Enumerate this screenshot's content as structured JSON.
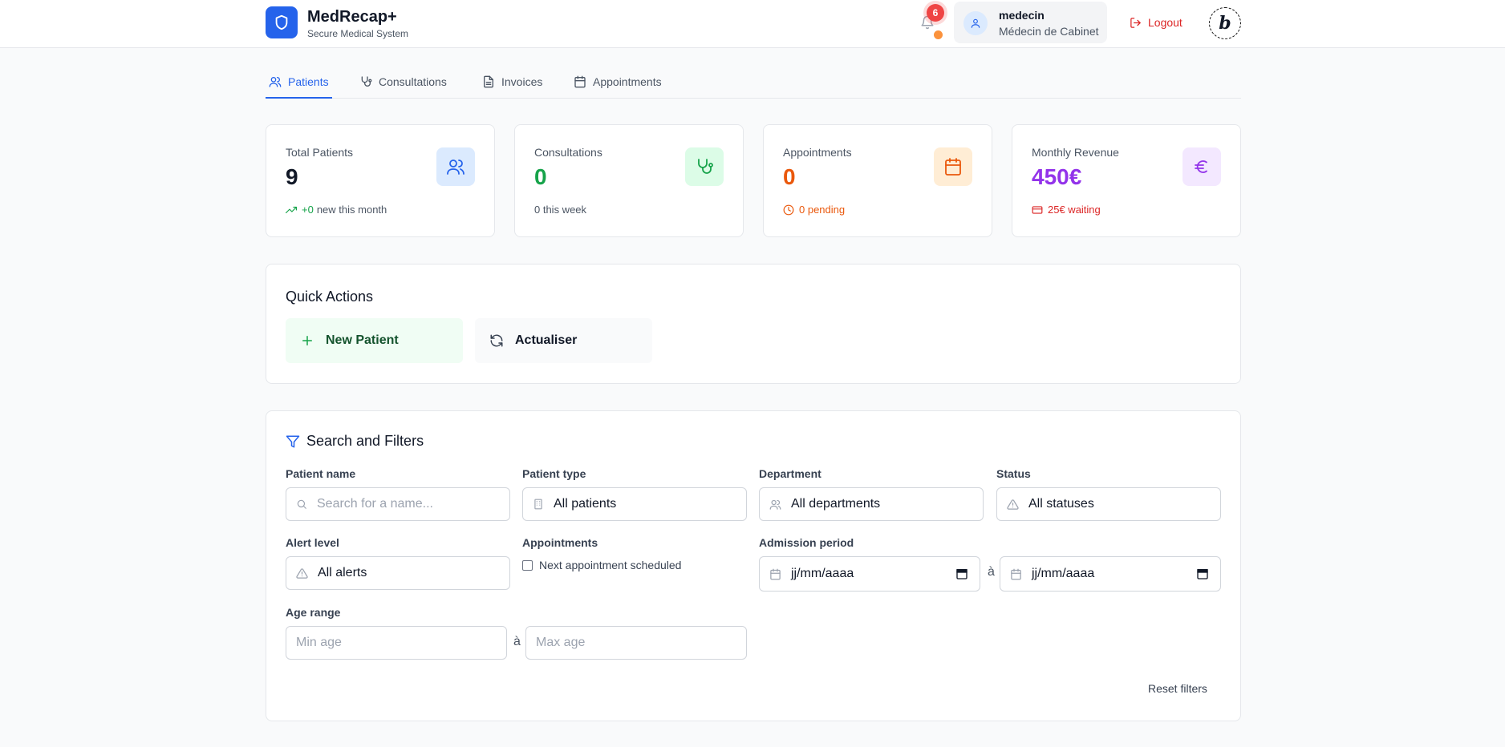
{
  "header": {
    "app_title": "MedRecap+",
    "app_subtitle": "Secure Medical System",
    "notifications_count": "6",
    "user_name": "medecin",
    "user_role": "Médecin de Cabinet",
    "logout_label": "Logout",
    "brand_letter": "b"
  },
  "tabs": [
    {
      "label": "Patients",
      "icon": "users-icon",
      "active": true
    },
    {
      "label": "Consultations",
      "icon": "stethoscope-icon",
      "active": false
    },
    {
      "label": "Invoices",
      "icon": "file-icon",
      "active": false
    },
    {
      "label": "Appointments",
      "icon": "calendar-icon",
      "active": false
    }
  ],
  "stats": [
    {
      "label": "Total Patients",
      "value": "9",
      "foot": "+0",
      "foot_suffix": " new this month",
      "value_color": "#111827",
      "foot_color": "#16a34a",
      "icon": "users-icon",
      "icon_bg": "#dbeafe",
      "icon_color": "#2563eb"
    },
    {
      "label": "Consultations",
      "value": "0",
      "foot": "0 this week",
      "value_color": "#16a34a",
      "foot_color": "#4b5563",
      "icon": "stethoscope-icon",
      "icon_bg": "#dcfce7",
      "icon_color": "#16a34a"
    },
    {
      "label": "Appointments",
      "value": "0",
      "foot": "0 pending",
      "value_color": "#ea580c",
      "foot_color": "#ea580c",
      "icon": "calendar-icon",
      "icon_bg": "#ffedd5",
      "icon_color": "#ea580c"
    },
    {
      "label": "Monthly Revenue",
      "value": "450€",
      "foot": "25€ waiting",
      "value_color": "#9333ea",
      "foot_color": "#dc2626",
      "icon": "euro-icon",
      "icon_bg": "#f3e8ff",
      "icon_color": "#9333ea"
    }
  ],
  "quick_actions": {
    "title": "Quick Actions",
    "new_patient": "New Patient",
    "refresh": "Actualiser"
  },
  "filters": {
    "title": "Search and Filters",
    "patient_name_label": "Patient name",
    "patient_name_placeholder": "Search for a name...",
    "patient_type_label": "Patient type",
    "patient_type_value": "All patients",
    "department_label": "Department",
    "department_value": "All departments",
    "status_label": "Status",
    "status_value": "All statuses",
    "alert_label": "Alert level",
    "alert_value": "All alerts",
    "appointments_label": "Appointments",
    "appointments_checkbox": "Next appointment scheduled",
    "admission_label": "Admission period",
    "date_placeholder": "jj/mm/aaaa",
    "range_sep": "à",
    "age_label": "Age range",
    "min_age_placeholder": "Min age",
    "max_age_placeholder": "Max age",
    "reset_label": "Reset filters"
  }
}
